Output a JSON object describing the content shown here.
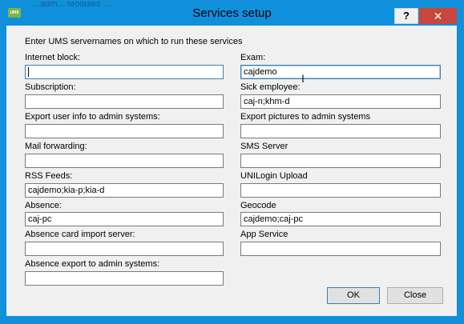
{
  "window": {
    "title": "Services setup",
    "background_caption": "...adm... Modules  ...",
    "app_icon_text": "UMS",
    "help_label": "?",
    "close_label": "✕"
  },
  "intro": "Enter UMS servernames on which to run these services",
  "fields_left": [
    {
      "label": "Internet block:",
      "value": ""
    },
    {
      "label": "Subscription:",
      "value": ""
    },
    {
      "label": "Export user info to admin systems:",
      "value": ""
    },
    {
      "label": "Mail forwarding:",
      "value": ""
    },
    {
      "label": "RSS Feeds:",
      "value": "cajdemo;kia-p;kia-d"
    },
    {
      "label": "Absence:",
      "value": "caj-pc"
    },
    {
      "label": "Absence card import server:",
      "value": ""
    },
    {
      "label": "Absence export to admin systems:",
      "value": ""
    }
  ],
  "fields_right": [
    {
      "label": "Exam:",
      "value": "cajdemo"
    },
    {
      "label": "Sick employee:",
      "value": "caj-n;khm-d"
    },
    {
      "label": "Export pictures to admin systems",
      "value": ""
    },
    {
      "label": "SMS Server",
      "value": ""
    },
    {
      "label": "UNILogin Upload",
      "value": ""
    },
    {
      "label": "Geocode",
      "value": "cajdemo;caj-pc"
    },
    {
      "label": "App Service",
      "value": ""
    }
  ],
  "buttons": {
    "ok": "OK",
    "close": "Close"
  }
}
